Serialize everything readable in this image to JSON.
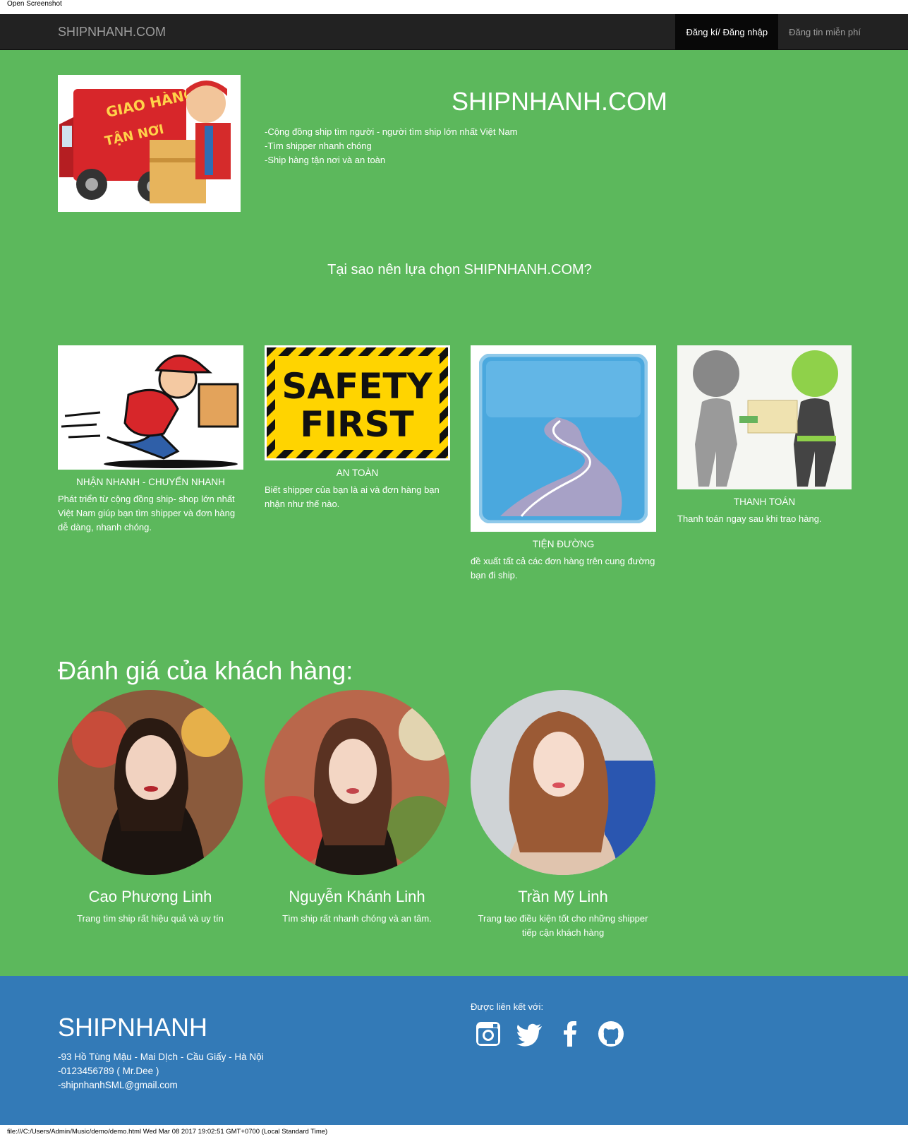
{
  "browser": {
    "top_label": "Open Screenshot",
    "status_text": "file:///C:/Users/Admin/Music/demo/demo.html Wed Mar 08 2017 19:02:51 GMT+0700 (Local Standard Time)"
  },
  "nav": {
    "brand": "SHIPNHANH.COM",
    "items": [
      {
        "label": "Đăng kí/ Đăng nhập",
        "active": true
      },
      {
        "label": "Đăng tin miễn phí",
        "active": false
      }
    ]
  },
  "hero": {
    "image_text_1": "GIAO HÀNG",
    "image_text_2": "TẬN NƠI",
    "title": "SHIPNHANH.COM",
    "lines": [
      "-Cộng đồng ship tìm người - người tìm ship lớn nhất Việt Nam",
      "-Tìm shipper nhanh chóng",
      "-Ship hàng tận nơi và an toàn"
    ]
  },
  "why": {
    "heading": "Tại sao nên lựa chọn SHIPNHANH.COM?"
  },
  "features": [
    {
      "caption": "NHẬN NHANH - CHUYỂN NHANH",
      "desc": " Phát triển từ cộng đồng ship- shop lớn nhất Việt Nam giúp bạn tìm shipper và đơn hàng dễ dàng, nhanh chóng."
    },
    {
      "caption": "AN TOÀN",
      "desc": "Biết shipper của bạn là ai và đơn hàng bạn nhận như thế nào.",
      "sign_1": "SAFETY",
      "sign_2": "FIRST"
    },
    {
      "caption": "TIỆN ĐƯỜNG",
      "desc": "đề xuất tất cả các đơn hàng trên cung đường bạn đi ship."
    },
    {
      "caption": "THANH TOÁN",
      "desc": "Thanh toán ngay sau khi trao hàng."
    }
  ],
  "reviews": {
    "heading": "Đánh giá của khách hàng:",
    "items": [
      {
        "name": "Cao Phương Linh",
        "text": "Trang tìm ship rất hiệu quả và uy tín"
      },
      {
        "name": "Nguyễn Khánh Linh",
        "text": "Tìm ship rất nhanh chóng và an tâm."
      },
      {
        "name": "Trần Mỹ Linh",
        "text": "Trang tạo điều kiện tốt cho những shipper tiếp cận khách hàng"
      }
    ]
  },
  "footer": {
    "brand": "SHIPNHANH",
    "address": "-93 Hồ Tùng Mậu - Mai DỊch - Cầu Giấy - Hà Nội",
    "phone": "-0123456789 ( Mr.Dee )",
    "email": "-shipnhanhSML@gmail.com",
    "connect_label": "Được liên kết với:",
    "socials": [
      "instagram-icon",
      "twitter-icon",
      "facebook-icon",
      "github-icon"
    ]
  },
  "colors": {
    "page_green": "#5cb85c",
    "footer_blue": "#337ab7",
    "navbar": "#222222"
  }
}
